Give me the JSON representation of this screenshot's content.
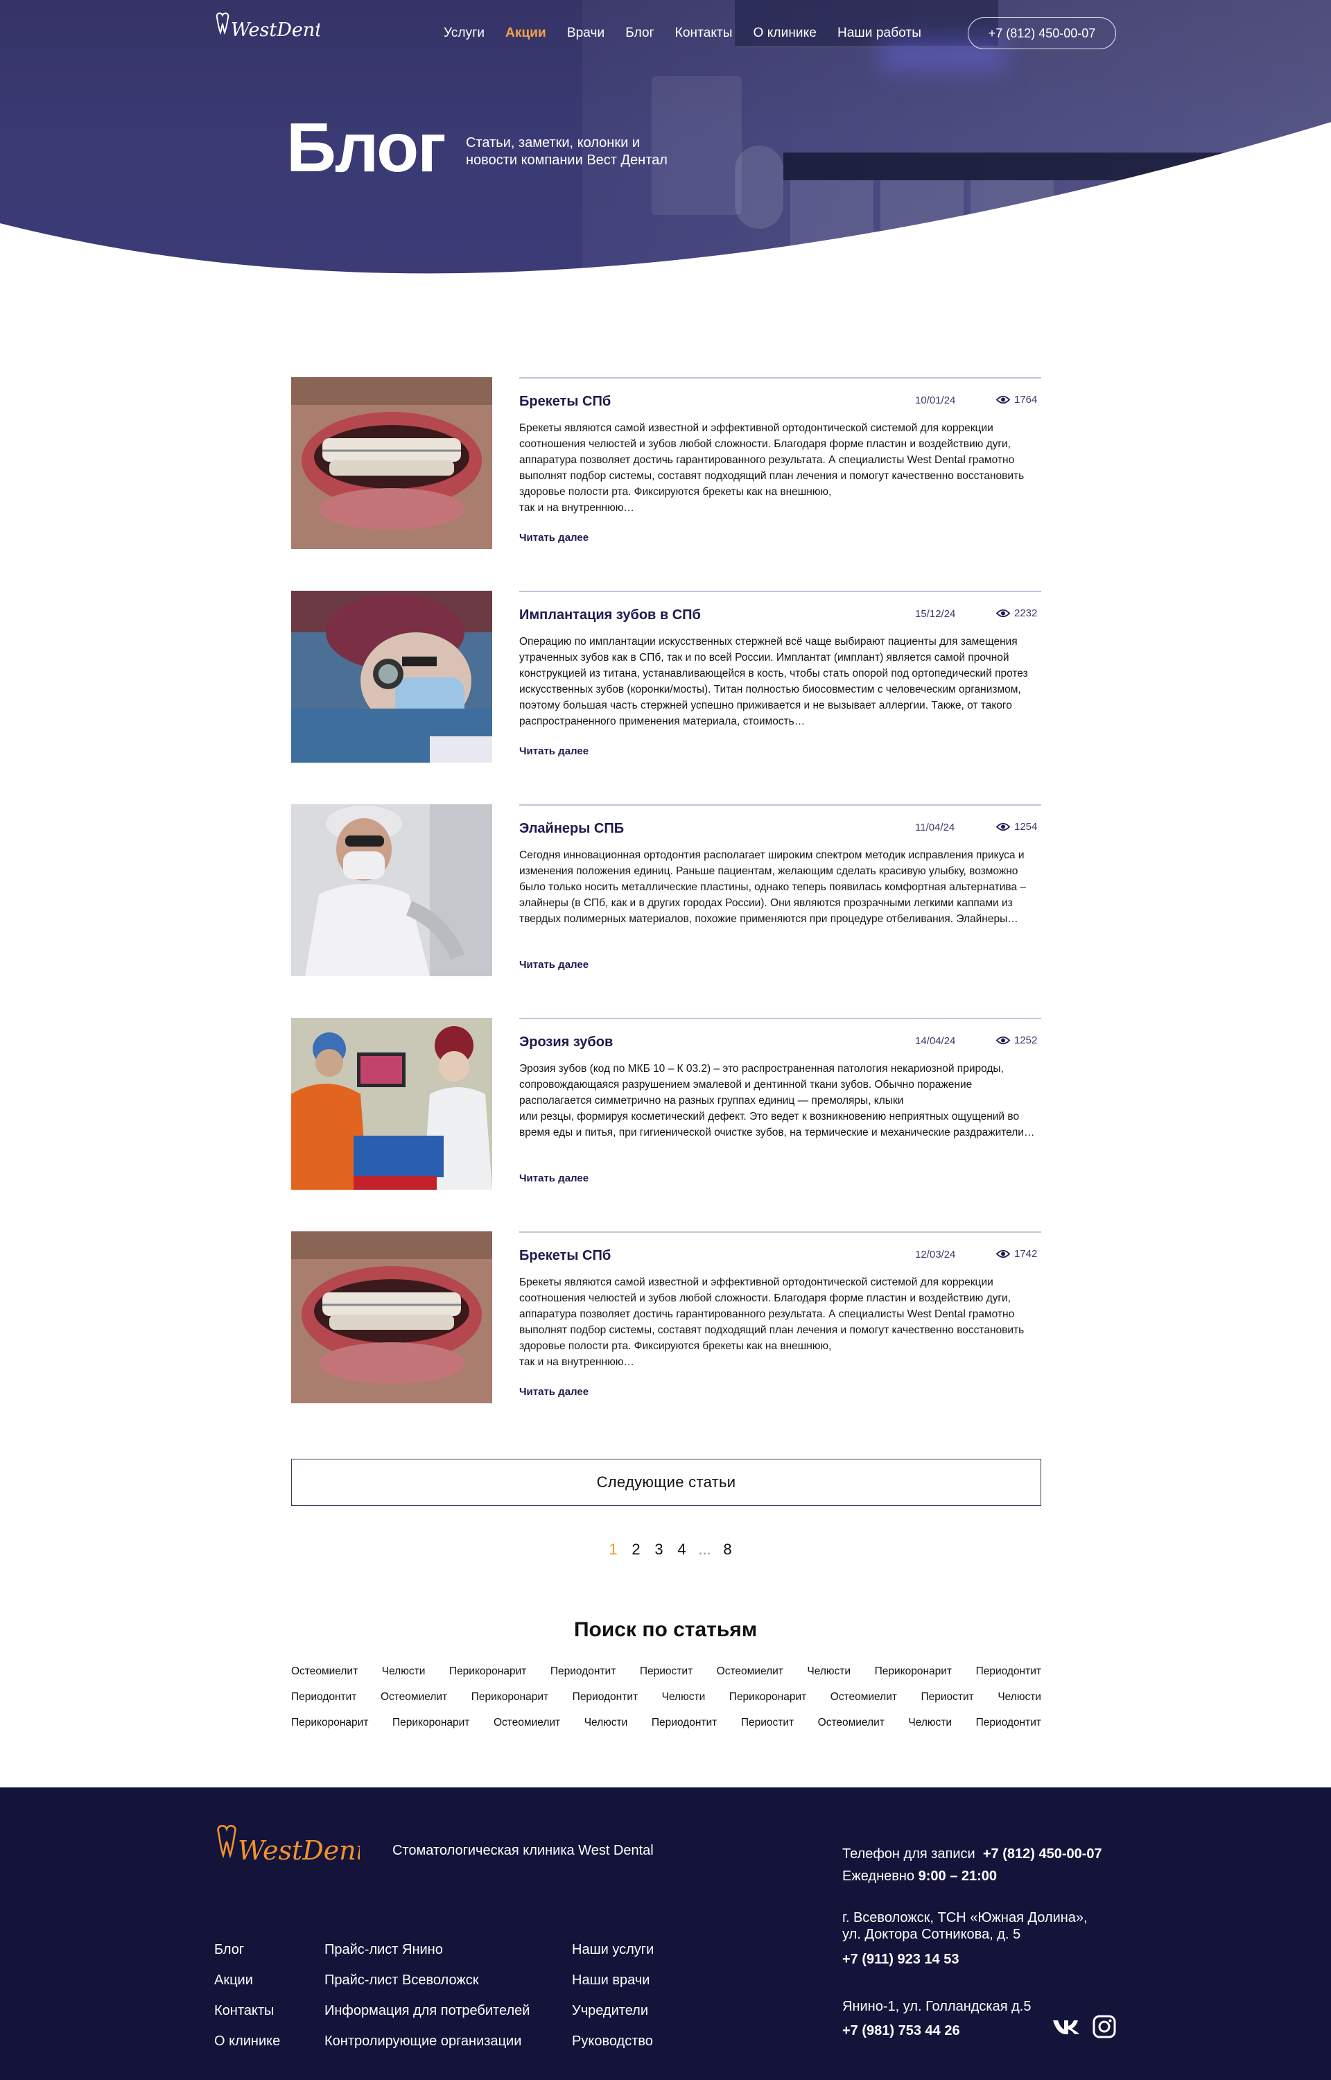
{
  "header": {
    "logo_text": "WestDental",
    "nav": [
      {
        "label": "Услуги",
        "active": false
      },
      {
        "label": "Акции",
        "active": true
      },
      {
        "label": "Врачи",
        "active": false
      },
      {
        "label": "Блог",
        "active": false
      },
      {
        "label": "Контакты",
        "active": false
      },
      {
        "label": "О клинике",
        "active": false
      },
      {
        "label": "Наши работы",
        "active": false
      }
    ],
    "phone": "+7 (812) 450-00-07"
  },
  "hero": {
    "title": "Блог",
    "subtitle": "Статьи, заметки, колонки и новости компании Вест Дентал"
  },
  "articles": [
    {
      "title": "Брекеты СПб",
      "date": "10/01/24",
      "views": "1764",
      "text": "Брекеты являются самой известной и эффективной ортодонтической системой для коррекции соотношения челюстей и зубов любой сложности. Благодаря форме пластин и воздействию дуги, аппаратура позволяет достичь гарантированного результата. А специалисты West Dental грамотно выполнят подбор системы, составят подходящий план лечения и помогут качественно восстановить здоровье полости рта. Фиксируются брекеты как на внешнюю,\nтак и на внутреннюю…",
      "more": "Читать далее",
      "image": "braces-smile"
    },
    {
      "title": "Имплантация зубов в СПб",
      "date": "15/12/24",
      "views": "2232",
      "text": "Операцию по имплантации искусственных стержней всё чаще выбирают пациенты для замещения утраченных зубов как в СПб, так и по всей России. Имплантат (имплант) является самой прочной конструкцией из титана, устанавливающейся в кость, чтобы стать опорой под ортопедический протез искусственных зубов (коронки/мосты). Титан полностью биосовместим с человеческим организмом, поэтому большая часть стержней успешно приживается и не вызывает аллергии. Также, от такого распространенного применения материала, стоимость…",
      "more": "Читать далее",
      "image": "surgeon-loupes"
    },
    {
      "title": "Элайнеры СПБ",
      "date": "11/04/24",
      "views": "1254",
      "text": "Сегодня инновационная ортодонтия располагает широким спектром методик исправления прикуса и изменения положения единиц. Раньше пациентам, желающим сделать красивую улыбку, возможно было только носить металлические пластины, однако теперь появилась комфортная альтернатива – элайнеры (в СПб, как и в других городах России). Они являются прозрачными легкими каппами из твердых полимерных материалов, похожие применяются при процедуре отбеливания. Элайнеры…",
      "more": "Читать далее",
      "image": "dentist-white"
    },
    {
      "title": "Эрозия зубов",
      "date": "14/04/24",
      "views": "1252",
      "text": "Эрозия зубов (код по МКБ 10 – К 03.2) – это распространенная патология некариозной природы, сопровождающаяся разрушением эмалевой и дентинной ткани зубов. Обычно поражение располагается симметрично на разных группах единиц — премоляры, клыки\nили резцы, формируя косметический дефект. Это ведет к возникновению неприятных ощущений во время еды и питья, при гигиенической очистке зубов, на термические и механические раздражители…",
      "more": "Читать далее",
      "image": "dental-procedure"
    },
    {
      "title": "Брекеты СПб",
      "date": "12/03/24",
      "views": "1742",
      "text": "Брекеты являются самой известной и эффективной ортодонтической системой для коррекции соотношения челюстей и зубов любой сложности. Благодаря форме пластин и воздействию дуги, аппаратура позволяет достичь гарантированного результата. А специалисты West Dental грамотно выполнят подбор системы, составят подходящий план лечения и помогут качественно восстановить здоровье полости рта. Фиксируются брекеты как на внешнюю,\nтак и на внутреннюю…",
      "more": "Читать далее",
      "image": "braces-smile"
    }
  ],
  "next_button": "Следующие статьи",
  "pagination": {
    "pages": [
      "1",
      "2",
      "3",
      "4",
      "...",
      "8"
    ],
    "current": "1"
  },
  "search": {
    "title": "Поиск по статьям",
    "tag_rows": [
      [
        "Остеомиелит",
        "Челюсти",
        "Перикоронарит",
        "Периодонтит",
        "Периостит",
        "Остеомиелит",
        "Челюсти",
        "Перикоронарит",
        "Периодонтит"
      ],
      [
        "Периодонтит",
        "Остеомиелит",
        "Перикоронарит",
        "Периодонтит",
        "Челюсти",
        "Перикоронарит",
        "Остеомиелит",
        "Периостит",
        "Челюсти"
      ],
      [
        "Перикоронарит",
        "Перикоронарит",
        "Остеомиелит",
        "Челюсти",
        "Периодонтит",
        "Периостит",
        "Остеомиелит",
        "Челюсти",
        "Периодонтит"
      ]
    ]
  },
  "footer": {
    "tagline": "Стоматологическая клиника West Dental",
    "booking_label": "Телефон для записи",
    "booking_phone": "+7 (812) 450-00-07",
    "hours_label": "Ежедневно",
    "hours": "9:00 – 21:00",
    "address1": "г. Всеволожск, ТСН «Южная Долина»,\nул. Доктора Сотникова, д. 5",
    "phone1": "+7 (911) 923 14 53",
    "address2": "Янино-1, ул. Голландская д.5",
    "phone2": "+7 (981) 753 44 26",
    "col1": [
      "Блог",
      "Акции",
      "Контакты",
      "О клинике"
    ],
    "col2": [
      "Прайс-лист Янино",
      "Прайс-лист Всеволожск",
      "Информация для потребителей",
      "Контролирующие организации"
    ],
    "col3": [
      "Наши услуги",
      "Наши врачи",
      "Учредители",
      "Руководство"
    ]
  },
  "colors": {
    "accent": "#f0942b",
    "navy": "#14133a",
    "hero": "#3a3a74"
  },
  "icons": [
    "eye-icon",
    "vk-icon",
    "instagram-icon"
  ]
}
